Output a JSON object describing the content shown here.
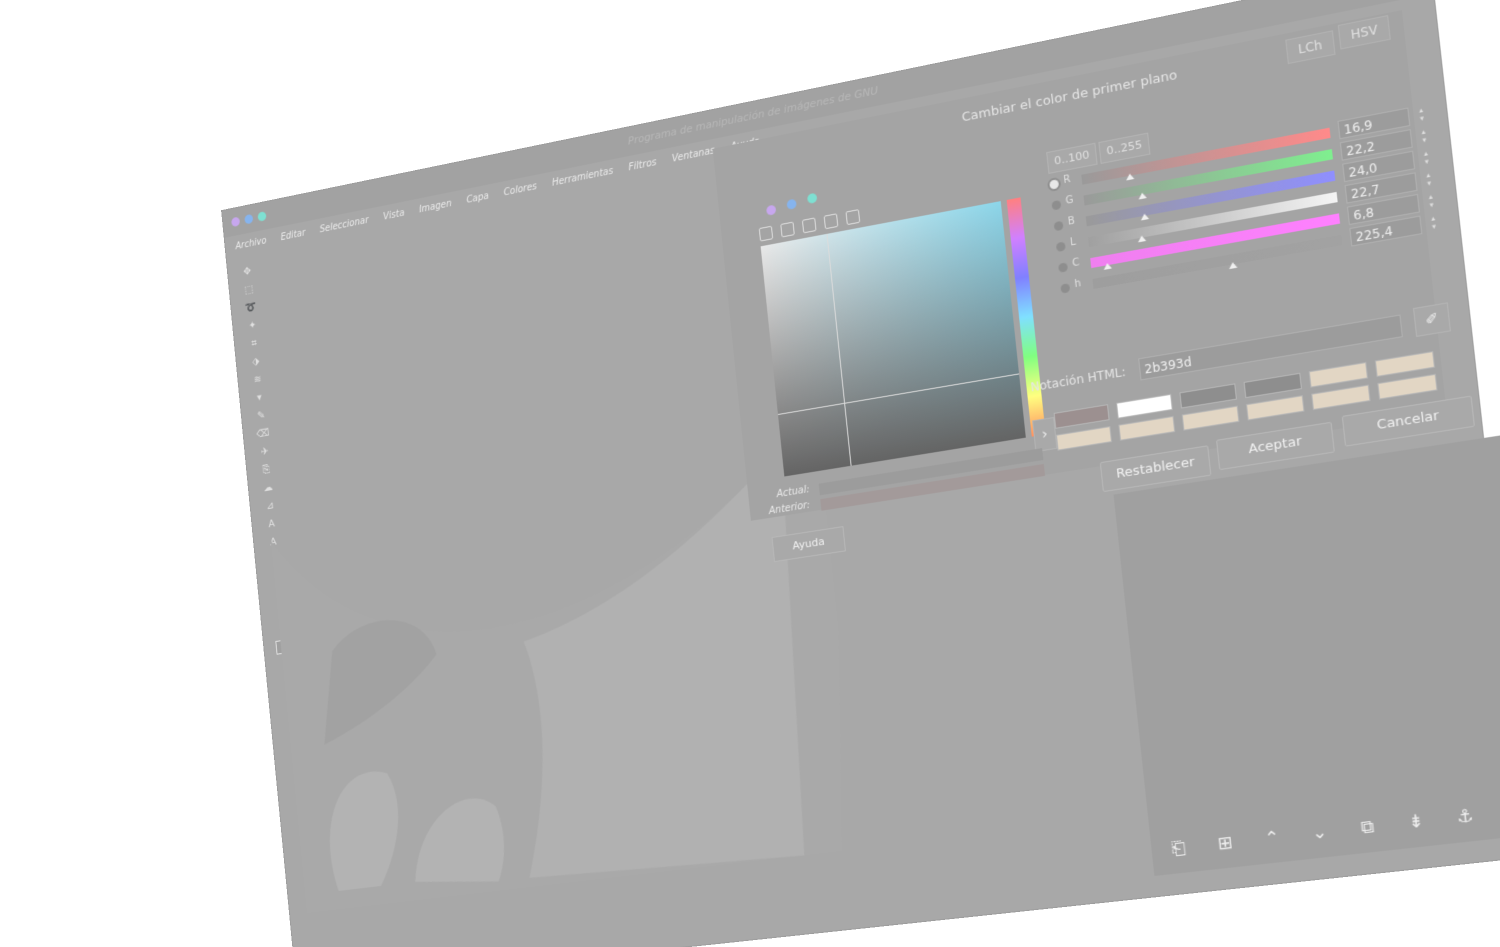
{
  "window": {
    "title": "Programa de manipulación de imágenes de GNU",
    "dots": [
      "#c7a7ee",
      "#86b4ee",
      "#7ee0d2"
    ]
  },
  "menubar": {
    "items": [
      "Archivo",
      "Editar",
      "Seleccionar",
      "Vista",
      "Imagen",
      "Capa",
      "Colores",
      "Herramientas",
      "Filtros",
      "Ventanas",
      "Ayuda"
    ]
  },
  "toolbox": {
    "icons": [
      "move-icon",
      "rect-select-icon",
      "lasso-icon",
      "fuzzy-select-icon",
      "crop-icon",
      "unified-transform-icon",
      "warp-icon",
      "bucket-fill-icon",
      "paintbrush-icon",
      "eraser-icon",
      "airbrush-icon",
      "clone-icon",
      "smudge-icon",
      "paths-icon",
      "text-icon",
      "color-picker-icon",
      "zoom-icon"
    ],
    "glyphs": [
      "✥",
      "⬚",
      "➰",
      "✦",
      "⌗",
      "⬗",
      "≋",
      "▾",
      "✎",
      "⌫",
      "✈",
      "⎘",
      "☁",
      "⊿",
      "A",
      "A",
      "⌕"
    ]
  },
  "dialog": {
    "title": "Cambiar el color de primer plano",
    "tabs": [
      "LCh",
      "HSV"
    ],
    "selector_dots": [
      "#c7a7ee",
      "#86b4ee",
      "#7ee0d2"
    ],
    "range_buttons": [
      "0..100",
      "0..255"
    ],
    "sliders": [
      {
        "label": "R",
        "value": "16,9",
        "selected": true,
        "from": "#9a9a9a",
        "to": "#ff8a8a"
      },
      {
        "label": "G",
        "value": "22,2",
        "selected": false,
        "from": "#9a9a9a",
        "to": "#7fef8f"
      },
      {
        "label": "B",
        "value": "24,0",
        "selected": false,
        "from": "#9a9a9a",
        "to": "#8f8fff"
      },
      {
        "label": "L",
        "value": "22,7",
        "selected": false,
        "from": "#a0a0a0",
        "to": "#f4f4f4"
      },
      {
        "label": "C",
        "value": "6,8",
        "selected": false,
        "from": "#ef7fef",
        "to": "#ff80ff"
      },
      {
        "label": "h",
        "value": "225,4",
        "selected": false,
        "from": "#9e9e9e",
        "to": "#a2a2a2"
      }
    ],
    "html_notation": {
      "label": "Notación HTML:",
      "value": "2b393d"
    },
    "history_swatches": [
      "#9c9090",
      "#ffffff",
      "#8e8e8e",
      "#8e8e8e",
      "#e2d6c4",
      "#e2d6c4",
      "#e2d6c4",
      "#e2d6c4",
      "#e2d6c4",
      "#e2d6c4",
      "#e2d6c4",
      "#e2d6c4"
    ],
    "current_label": "Actual:",
    "previous_label": "Anterior:",
    "buttons": {
      "reset": "Restablecer",
      "ok": "Aceptar",
      "cancel": "Cancelar",
      "help": "Ayuda"
    }
  },
  "layers_panel": {
    "icons": [
      "new-layer-icon",
      "new-layer-group-icon",
      "raise-layer-icon",
      "lower-layer-icon",
      "duplicate-layer-icon",
      "merge-down-icon",
      "anchor-layer-icon",
      "delete-layer-icon"
    ],
    "glyphs": [
      "⎗",
      "⊞",
      "⌃",
      "⌄",
      "⧉",
      "⇟",
      "⚓",
      "⊠"
    ]
  }
}
